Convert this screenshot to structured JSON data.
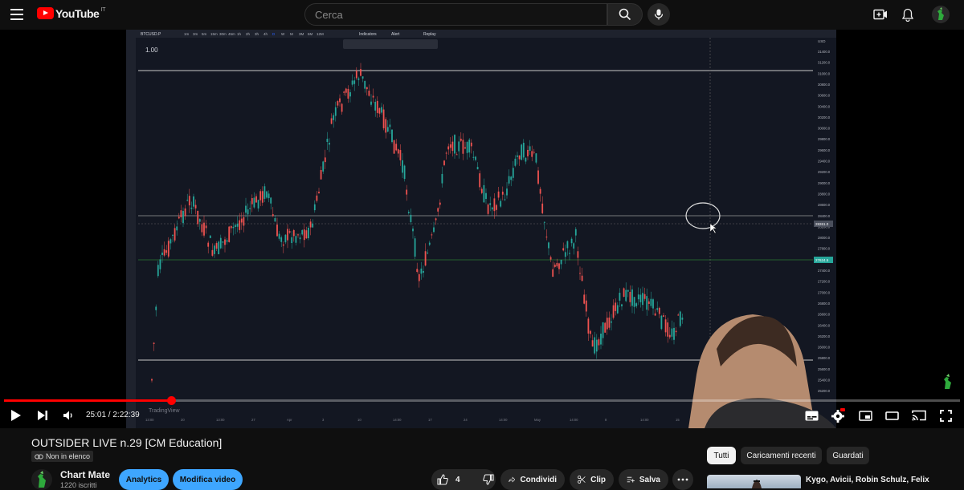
{
  "header": {
    "logo_text": "YouTube",
    "country_code": "IT",
    "search_placeholder": "Cerca"
  },
  "player": {
    "current_time": "25:01",
    "duration": "2:22:39",
    "time_separator": " / ",
    "progress_fraction": 0.175,
    "chart_overlay": {
      "symbol": "BTCUSD.P",
      "price_tag": "1.00",
      "timeframes": [
        "1m",
        "3m",
        "5m",
        "15m",
        "30m",
        "45m",
        "1h",
        "2h",
        "3h",
        "4h",
        "D",
        "W",
        "M",
        "3M",
        "6M",
        "12M"
      ],
      "toolbar": [
        "Indicators",
        "Alert",
        "Replay"
      ],
      "brand": "TradingView",
      "price_axis": [
        "31400.0",
        "31200.0",
        "31000.0",
        "30800.0",
        "30600.0",
        "30400.0",
        "30200.0",
        "30000.0",
        "29800.0",
        "29600.0",
        "29400.0",
        "29200.0",
        "29000.0",
        "28800.0",
        "28600.0",
        "28400.0",
        "28200.0",
        "28000.0",
        "27800.0",
        "27600.0",
        "27400.0",
        "27200.0",
        "27000.0",
        "26800.0",
        "26600.0",
        "26400.0",
        "26200.0",
        "26000.0",
        "25800.0",
        "25600.0",
        "25400.0",
        "25200.0"
      ],
      "price_marker": "28261.0",
      "current_price": "27624.5",
      "time_axis": [
        "13:00",
        "20",
        "13:00",
        "27",
        "Apr",
        "3",
        "10",
        "14:00",
        "17",
        "24",
        "14:00",
        "May",
        "14:00",
        "8",
        "14:00",
        "15",
        "14:00",
        "22",
        "29"
      ],
      "currency": "USD"
    }
  },
  "video": {
    "title": "OUTSIDER LIVE n.29 [CM Education]",
    "visibility": "Non in elenco"
  },
  "channel": {
    "name": "Chart Mate",
    "subscribers": "1220 iscritti"
  },
  "actions": {
    "analytics": "Analytics",
    "edit": "Modifica video",
    "likes": "4",
    "share": "Condividi",
    "clip": "Clip",
    "save": "Salva"
  },
  "filters": [
    "Tutti",
    "Caricamenti recenti",
    "Guardati"
  ],
  "recommended": {
    "title": "Kygo, Avicii, Robin Schulz, Felix"
  },
  "colors": {
    "youtube_red": "#ff0000",
    "accent_blue": "#3ea6ff",
    "chart_bg": "#131722",
    "candle_up": "#26a69a",
    "candle_down": "#ef5350"
  }
}
